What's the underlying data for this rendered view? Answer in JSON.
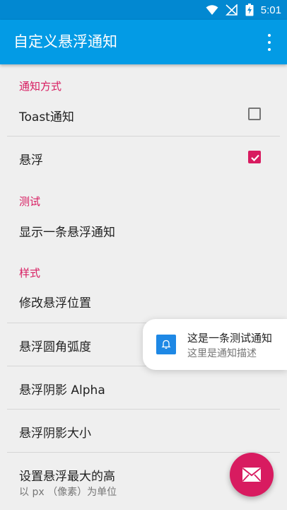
{
  "status_bar": {
    "time": "5:01",
    "icons": [
      "wifi-icon",
      "signal-off-icon",
      "battery-charging-icon"
    ]
  },
  "app_bar": {
    "title": "自定义悬浮通知",
    "menu_icon": "more-vert-icon"
  },
  "categories": {
    "notify_method": "通知方式",
    "test": "测试",
    "style": "样式"
  },
  "prefs": {
    "toast": {
      "title": "Toast通知",
      "checked": false
    },
    "float": {
      "title": "悬浮",
      "checked": true
    },
    "show_one": {
      "title": "显示一条悬浮通知"
    },
    "position": {
      "title": "修改悬浮位置"
    },
    "radius": {
      "title": "悬浮圆角弧度"
    },
    "shadow_alpha": {
      "title": "悬浮阴影 Alpha"
    },
    "shadow_size": {
      "title": "悬浮阴影大小"
    },
    "max_height": {
      "title": "设置悬浮最大的高",
      "summary": "以 px （像素）为单位"
    }
  },
  "floating_notification": {
    "title": "这是一条测试通知",
    "description": "这里是通知描述",
    "icon": "bell-icon"
  },
  "fab": {
    "icon": "mail-icon"
  },
  "colors": {
    "status_bar": "#0288d1",
    "app_bar": "#039be5",
    "accent": "#d81b60",
    "background": "#efefef"
  }
}
